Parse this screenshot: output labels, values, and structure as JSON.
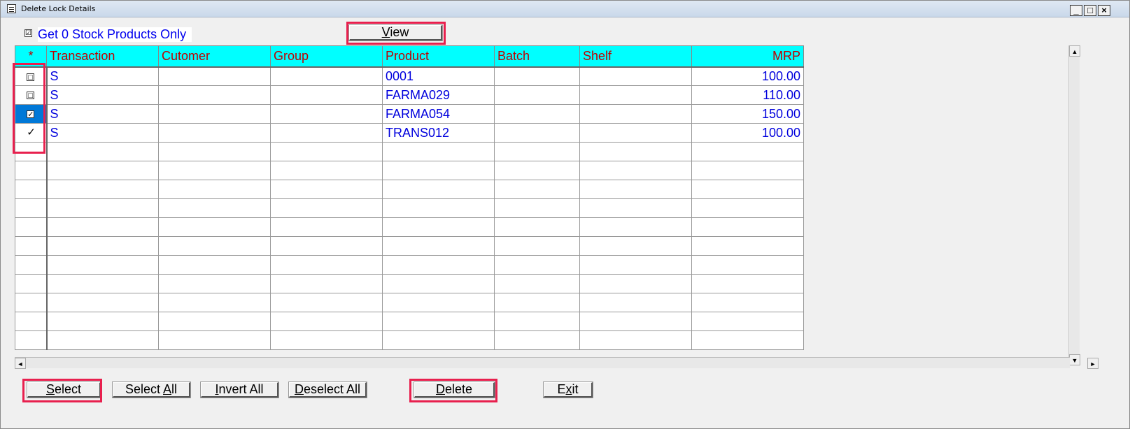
{
  "window": {
    "title": "Delete Lock Details",
    "controls": {
      "minimize": "_",
      "maximize": "□",
      "close": "×"
    }
  },
  "filter": {
    "checkbox_checked": true,
    "checkbox_glyph": "☑",
    "label": "Get 0 Stock Products Only"
  },
  "toolbar": {
    "view_prefix": "",
    "view_underlined": "V",
    "view_rest": "iew"
  },
  "grid": {
    "columns": {
      "star": "*",
      "transaction": "Transaction",
      "customer": "Cutomer",
      "group": "Group",
      "product": "Product",
      "batch": "Batch",
      "shelf": "Shelf",
      "mrp": "MRP"
    },
    "rows": [
      {
        "check": "□",
        "transaction": "S",
        "customer": "",
        "group": "",
        "product": "0001",
        "batch": "",
        "shelf": "",
        "mrp": "100.00"
      },
      {
        "check": "□",
        "transaction": "S",
        "customer": "",
        "group": "",
        "product": "FARMA029",
        "batch": "",
        "shelf": "",
        "mrp": "110.00"
      },
      {
        "check": "✓",
        "transaction": "S",
        "customer": "",
        "group": "",
        "product": "FARMA054",
        "batch": "",
        "shelf": "",
        "mrp": "150.00"
      },
      {
        "check": "✓",
        "transaction": "S",
        "customer": "",
        "group": "",
        "product": "TRANS012",
        "batch": "",
        "shelf": "",
        "mrp": "100.00"
      }
    ],
    "empty_rows": 11
  },
  "buttons": {
    "select": {
      "u": "S",
      "rest": "elect"
    },
    "select_all": {
      "pre": "Select ",
      "u": "A",
      "rest": "ll"
    },
    "invert_all": {
      "u": "I",
      "rest": "nvert All"
    },
    "deselect_all": {
      "u": "D",
      "rest": "eselect All"
    },
    "delete": {
      "u": "D",
      "rest": "elete"
    },
    "exit": {
      "pre": "E",
      "u": "x",
      "rest": "it"
    }
  },
  "scroll": {
    "up": "▲",
    "down": "▼",
    "left": "◄",
    "right": "►"
  },
  "colors": {
    "header_bg": "#00ffff",
    "header_text": "#c00000",
    "cell_text": "#0000dd",
    "highlight": "#e8204e",
    "selected_row": "#0078d7"
  }
}
